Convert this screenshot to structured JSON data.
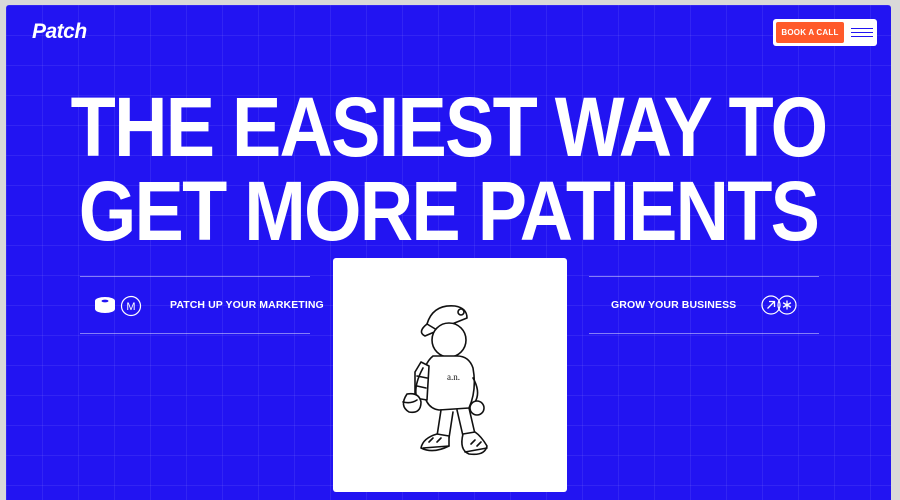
{
  "brand": {
    "logo": "Patch"
  },
  "nav": {
    "cta_label": "BOOK A CALL",
    "menu_icon": "hamburger-icon"
  },
  "hero": {
    "line1": "THE EASIEST WAY TO",
    "line2": "GET MORE PATIENTS"
  },
  "features": {
    "left_label": "PATCH UP YOUR MARKETING",
    "left_icons": [
      "tape-icon",
      "m-badge-icon"
    ],
    "m_badge_text": "M",
    "right_label": "GROW YOUR BUSINESS",
    "right_icons": [
      "arrow-up-right-icon",
      "asterisk-icon"
    ]
  },
  "illustration": {
    "shirt_text": "a.n.",
    "icon": "walking-character-illustration"
  },
  "colors": {
    "background": "#2214f2",
    "accent": "#ff5a2a",
    "text": "#ffffff"
  }
}
